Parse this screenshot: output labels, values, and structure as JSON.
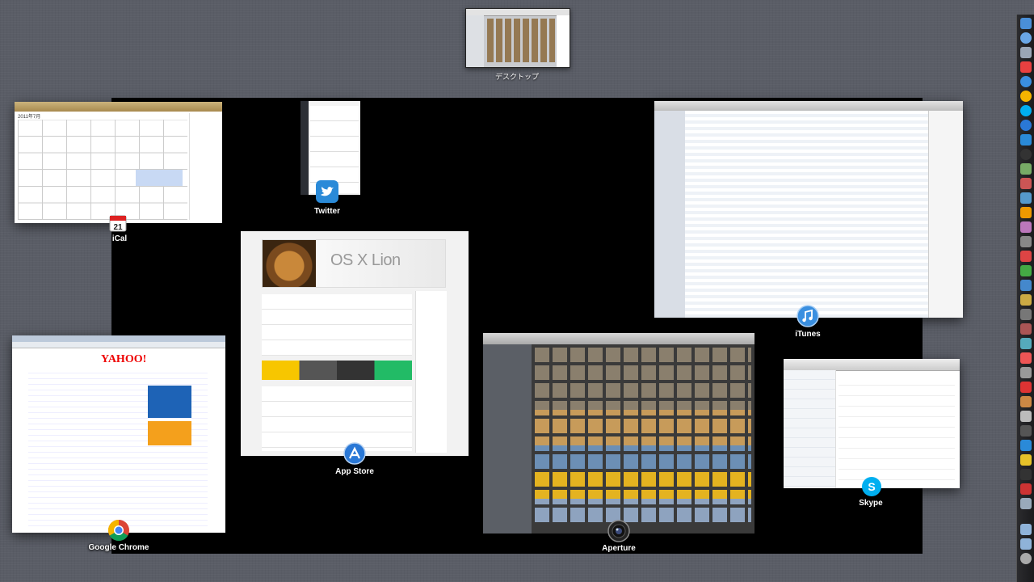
{
  "space": {
    "label": "デスクトップ"
  },
  "windows": {
    "ical": {
      "label": "iCal",
      "month": "2011年7月",
      "date_icon": "21"
    },
    "twitter": {
      "label": "Twitter"
    },
    "appstore": {
      "label": "App Store",
      "hero": "OS X Lion"
    },
    "itunes": {
      "label": "iTunes"
    },
    "chrome": {
      "label": "Google Chrome",
      "logo": "YAHOO!"
    },
    "aperture": {
      "label": "Aperture"
    },
    "skype": {
      "label": "Skype"
    }
  },
  "dock": {
    "icons": [
      "finder-icon",
      "safari-icon",
      "mail-icon",
      "ical-icon",
      "itunes-icon",
      "chrome-icon",
      "skype-icon",
      "app-store-icon",
      "twitter-icon",
      "aperture-icon",
      "trash-icon"
    ]
  },
  "colors": {
    "accent_blue": "#2a78d6",
    "desk_black": "#000000"
  }
}
